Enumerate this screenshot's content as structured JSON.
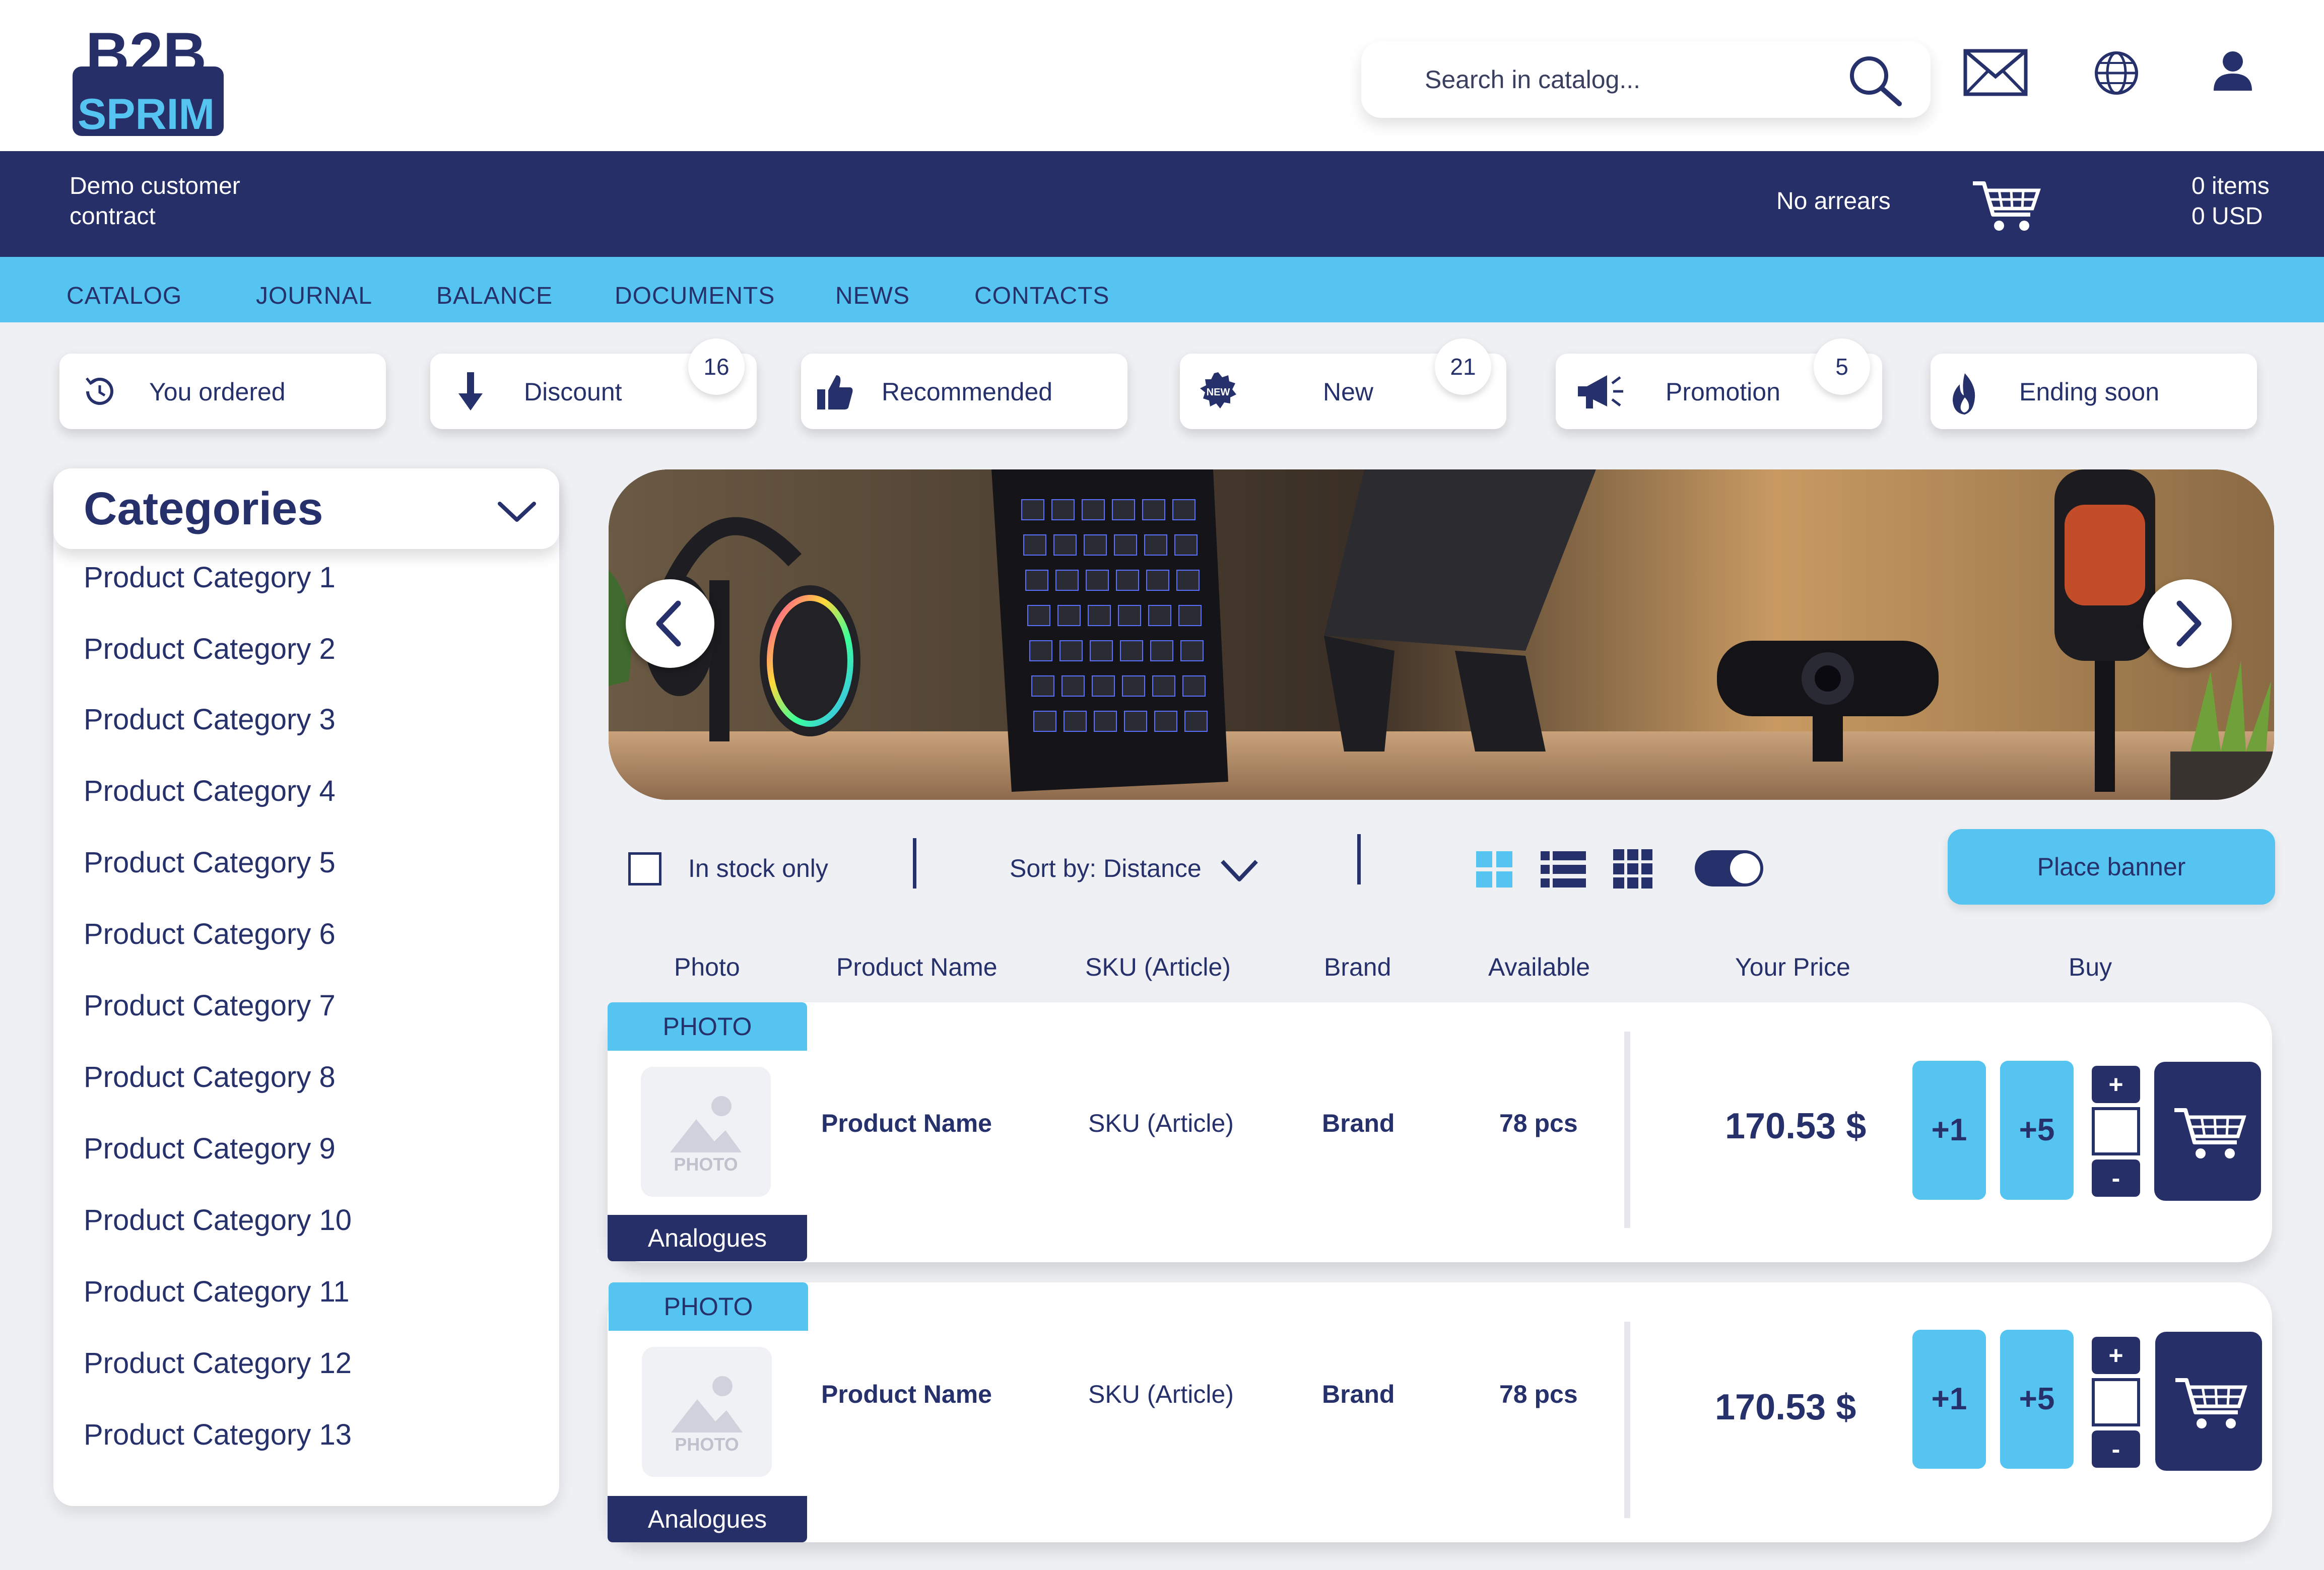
{
  "brand": {
    "logo_text_top": "B2B",
    "logo_text_bottom": "SPRIM"
  },
  "header": {
    "search_placeholder": "Search in catalog...",
    "icons": [
      "search-icon",
      "mail-icon",
      "globe-icon",
      "user-icon"
    ]
  },
  "account_bar": {
    "contract_line1": "Demo customer",
    "contract_line2": "contract",
    "arrears": "No arrears",
    "cart_items": "0 items",
    "cart_total": "0 USD"
  },
  "nav": [
    "CATALOG",
    "JOURNAL",
    "BALANCE",
    "DOCUMENTS",
    "NEWS",
    "CONTACTS"
  ],
  "quick_filters": [
    {
      "label": "You ordered",
      "icon": "history-icon",
      "badge": ""
    },
    {
      "label": "Discount",
      "icon": "arrow-down-icon",
      "badge": "16"
    },
    {
      "label": "Recommended",
      "icon": "thumbs-up-icon",
      "badge": ""
    },
    {
      "label": "New",
      "icon": "new-seal-icon",
      "badge": "21",
      "icon_text": "NEW"
    },
    {
      "label": "Promotion",
      "icon": "megaphone-icon",
      "badge": "5"
    },
    {
      "label": "Ending soon",
      "icon": "flame-icon",
      "badge": ""
    }
  ],
  "sidebar": {
    "title": "Categories",
    "items": [
      "Product Category 1",
      "Product Category 2",
      "Product Category 3",
      "Product Category 4",
      "Product Category 5",
      "Product Category 6",
      "Product Category 7",
      "Product Category 8",
      "Product Category 9",
      "Product Category 10",
      "Product Category 11",
      "Product Category 12",
      "Product Category 13"
    ]
  },
  "toolbar": {
    "in_stock_label": "In stock only",
    "in_stock_checked": false,
    "sort_label": "Sort by: Distance",
    "view_modes": [
      "tile-view-icon",
      "list-view-icon",
      "grid-view-icon"
    ],
    "toggle_on": true,
    "place_banner_label": "Place banner"
  },
  "table": {
    "columns": [
      "Photo",
      "Product Name",
      "SKU (Article)",
      "Brand",
      "Available",
      "Your Price",
      "Buy"
    ],
    "rows": [
      {
        "photo_tag": "PHOTO",
        "thumb_text": "PHOTO",
        "analogues": "Analogues",
        "name": "Product Name",
        "sku": "SKU (Article)",
        "brand": "Brand",
        "available": "78 pcs",
        "price": "170.53 $",
        "plus1": "+1",
        "plus5": "+5",
        "inc": "+",
        "dec": "-"
      },
      {
        "photo_tag": "PHOTO",
        "thumb_text": "PHOTO",
        "analogues": "Analogues",
        "name": "Product Name",
        "sku": "SKU (Article)",
        "brand": "Brand",
        "available": "78 pcs",
        "price": "170.53 $",
        "plus1": "+1",
        "plus5": "+5",
        "inc": "+",
        "dec": "-"
      }
    ]
  },
  "colors": {
    "navy": "#272f68",
    "sky": "#55c4f1",
    "text": "#26306a"
  }
}
